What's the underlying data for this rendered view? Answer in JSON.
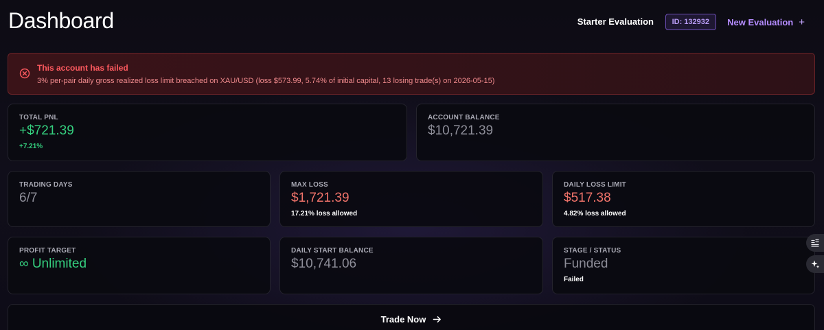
{
  "header": {
    "title": "Dashboard",
    "evaluation_name": "Starter Evaluation",
    "id_badge": "ID: 132932",
    "new_evaluation_label": "New Evaluation",
    "new_evaluation_icon": "plus-icon"
  },
  "alert": {
    "icon": "x-circle-icon",
    "title": "This account has failed",
    "message": "3% per-pair daily gross realized loss limit breached on XAU/USD (loss $573.99, 5.74% of initial capital, 13 losing trade(s) on 2026-05-15)"
  },
  "cards": {
    "total_pnl": {
      "label": "TOTAL PNL",
      "value": "+$721.39",
      "sub": "+7.21%"
    },
    "account_balance": {
      "label": "ACCOUNT BALANCE",
      "value": "$10,721.39"
    },
    "trading_days": {
      "label": "TRADING DAYS",
      "value": "6/7"
    },
    "max_loss": {
      "label": "MAX LOSS",
      "value": "$1,721.39",
      "sub": "17.21% loss allowed"
    },
    "daily_loss_limit": {
      "label": "DAILY LOSS LIMIT",
      "value": "$517.38",
      "sub": "4.82% loss allowed"
    },
    "profit_target": {
      "label": "PROFIT TARGET",
      "value": "∞ Unlimited"
    },
    "daily_start_balance": {
      "label": "DAILY START BALANCE",
      "value": "$10,741.06"
    },
    "stage_status": {
      "label": "STAGE / STATUS",
      "value": "Funded",
      "sub": "Failed"
    }
  },
  "trade_now": {
    "label": "Trade Now",
    "icon": "arrow-right-icon"
  },
  "side_buttons": [
    {
      "icon": "list-settings-icon"
    },
    {
      "icon": "sparkles-icon"
    }
  ],
  "colors": {
    "accent": "#b58cff",
    "positive": "#35d07f",
    "negative": "#f0736a",
    "alert_text": "#ff5a5f",
    "alert_bg": "#3a1318"
  }
}
